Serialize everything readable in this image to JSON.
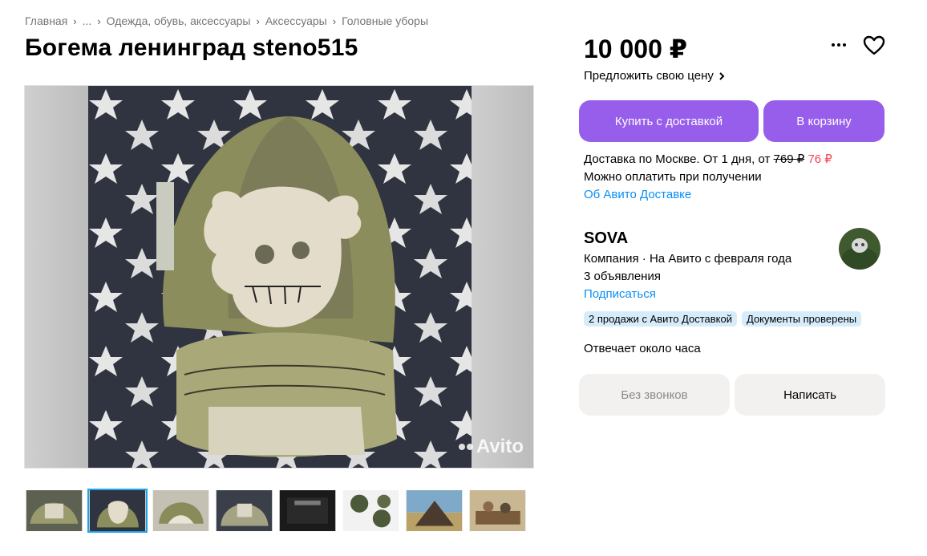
{
  "breadcrumbs": [
    "Главная",
    "...",
    "Одежда, обувь, аксессуары",
    "Аксессуары",
    "Головные уборы"
  ],
  "breadcrumb_separator": "›",
  "title": "Богема ленинград steno515",
  "price": "10 000 ₽",
  "offer_price_label": "Предложить свою цену",
  "buttons": {
    "buy_with_delivery": "Купить с доставкой",
    "add_to_cart": "В корзину",
    "no_calls": "Без звонков",
    "write": "Написать"
  },
  "delivery": {
    "line_prefix": "Доставка по Москве. От 1 дня, от ",
    "old_price": "769 ₽",
    "new_price": "76 ₽",
    "pay_on_receipt": "Можно оплатить при получении",
    "about_link": "Об Авито Доставке"
  },
  "seller": {
    "name": "SOVA",
    "meta": "Компания · На Авито с февраля года",
    "listings": "3 объявления",
    "subscribe": "Подписаться",
    "badges": [
      "2 продажи с Авито Доставкой",
      "Документы проверены"
    ],
    "reply_time": "Отвечает около часа"
  },
  "gallery": {
    "watermark": "Avito",
    "thumbnail_count": 8,
    "active_thumbnail": 2
  },
  "colors": {
    "accent_purple": "#965eeb",
    "link_blue": "#0a8ff5",
    "discount_red": "#ff4053",
    "badge_blue": "#d6ecfb"
  }
}
